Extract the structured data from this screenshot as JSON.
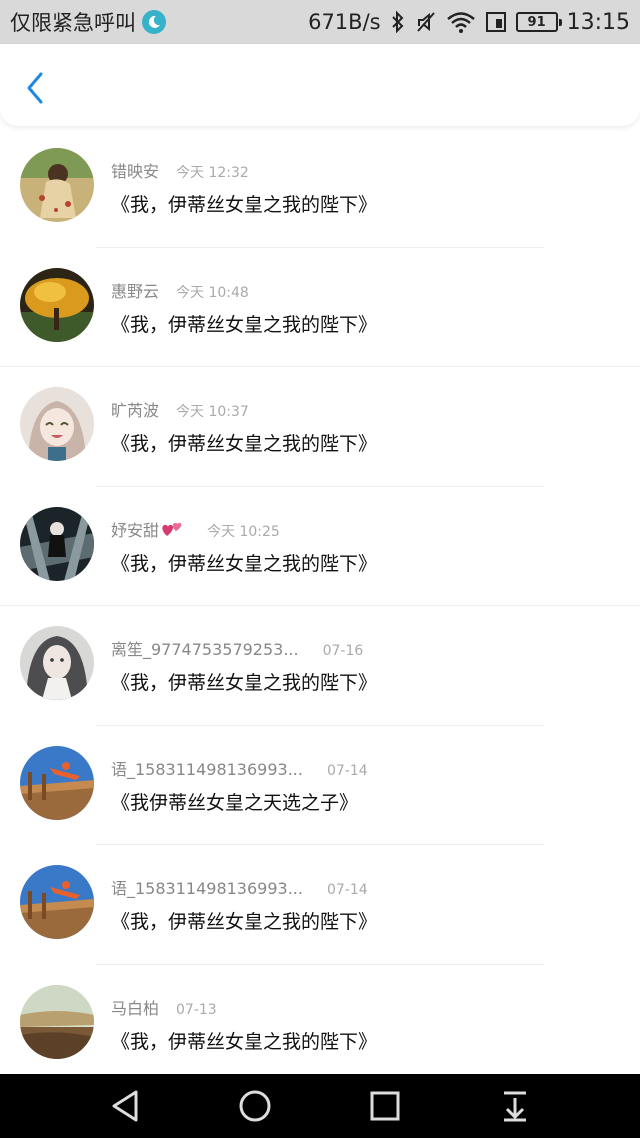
{
  "status_bar": {
    "carrier": "仅限紧急呼叫",
    "speed": "671B/s",
    "battery": "91",
    "time": "13:15"
  },
  "header": {
    "back_icon": "chevron-left-icon",
    "accent_color": "#1e88e5"
  },
  "comments": [
    {
      "name": "错映安",
      "time": "今天 12:32",
      "message": "《我，伊蒂丝女皇之我的陛下》"
    },
    {
      "name": "惠野云",
      "time": "今天 10:48",
      "message": "《我，伊蒂丝女皇之我的陛下》"
    },
    {
      "name": "旷芮波",
      "time": "今天 10:37",
      "message": "《我，伊蒂丝女皇之我的陛下》"
    },
    {
      "name": "妤安甜",
      "time": "今天 10:25",
      "message": "《我，伊蒂丝女皇之我的陛下》"
    },
    {
      "name": "离笙_9774753579253...",
      "time": "07-16",
      "message": "《我，伊蒂丝女皇之我的陛下》"
    },
    {
      "name": "语_158311498136993...",
      "time": "07-14",
      "message": "《我伊蒂丝女皇之天选之子》"
    },
    {
      "name": "语_158311498136993...",
      "time": "07-14",
      "message": "《我，伊蒂丝女皇之我的陛下》"
    },
    {
      "name": "马白柏",
      "time": "07-13",
      "message": "《我，伊蒂丝女皇之我的陛下》"
    }
  ],
  "nav_bar": {
    "back": "triangle-back-icon",
    "home": "circle-home-icon",
    "recents": "square-recents-icon",
    "notifications": "pull-down-icon"
  }
}
